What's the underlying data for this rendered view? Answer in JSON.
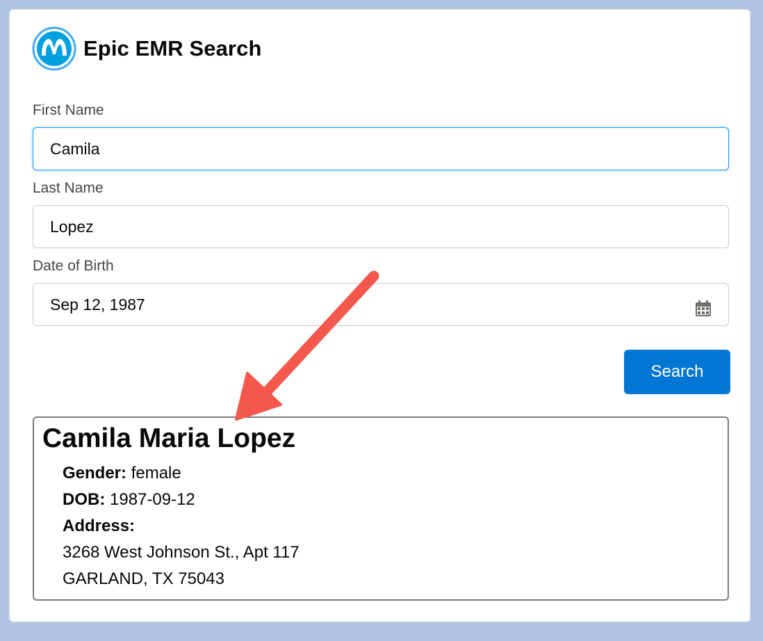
{
  "app": {
    "title": "Epic EMR Search",
    "accent_color": "#0176d3",
    "logo_icon": "mulesoft-logo-icon"
  },
  "form": {
    "first_name": {
      "label": "First Name",
      "value": "Camila"
    },
    "last_name": {
      "label": "Last Name",
      "value": "Lopez"
    },
    "dob": {
      "label": "Date of Birth",
      "value": "Sep 12, 1987",
      "icon": "calendar-icon"
    },
    "search_label": "Search"
  },
  "result": {
    "full_name": "Camila Maria Lopez",
    "gender_label": "Gender:",
    "gender": "female",
    "dob_label": "DOB:",
    "dob": "1987-09-12",
    "address_label": "Address:",
    "address_line1": "3268 West Johnson St., Apt 117",
    "address_line2": "GARLAND, TX 75043"
  },
  "annotation": {
    "arrow_color": "#f4574c"
  }
}
